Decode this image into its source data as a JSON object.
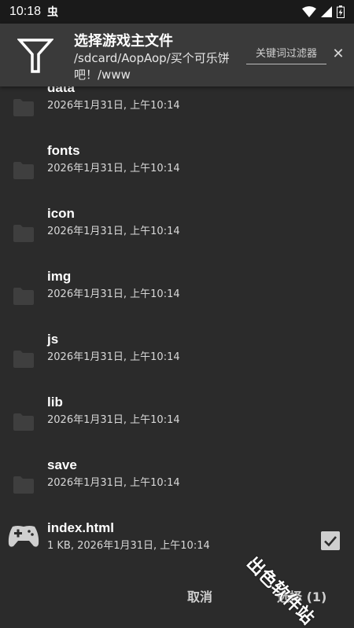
{
  "status_bar": {
    "time": "10:18",
    "notification_glyph": "虫"
  },
  "header": {
    "title": "选择游戏主文件",
    "path": "/sdcard/AopAop/买个可乐饼吧！/www",
    "keyword_placeholder": "关键词过滤器",
    "keyword_value": ""
  },
  "files": [
    {
      "name": "data",
      "meta": "2026年1月31日, 上午10:14",
      "type": "folder"
    },
    {
      "name": "fonts",
      "meta": "2026年1月31日, 上午10:14",
      "type": "folder"
    },
    {
      "name": "icon",
      "meta": "2026年1月31日, 上午10:14",
      "type": "folder"
    },
    {
      "name": "img",
      "meta": "2026年1月31日, 上午10:14",
      "type": "folder"
    },
    {
      "name": "js",
      "meta": "2026年1月31日, 上午10:14",
      "type": "folder"
    },
    {
      "name": "lib",
      "meta": "2026年1月31日, 上午10:14",
      "type": "folder"
    },
    {
      "name": "save",
      "meta": "2026年1月31日, 上午10:14",
      "type": "folder"
    },
    {
      "name": "index.html",
      "meta": "1 KB, 2026年1月31日, 上午10:14",
      "type": "game-file",
      "checked": true
    }
  ],
  "footer": {
    "cancel_label": "取消",
    "select_label": "选择 (1)"
  },
  "watermark": "出色软件站",
  "colors": {
    "background": "#2b2b2b",
    "header": "#3a3a3a",
    "status_bar": "#1a1a1a",
    "folder_icon": "#3f3f3f"
  },
  "icons": {
    "header": "filter-icon",
    "folder": "folder-icon",
    "game": "gamepad-icon",
    "checkbox": "checkbox-checked-icon"
  }
}
